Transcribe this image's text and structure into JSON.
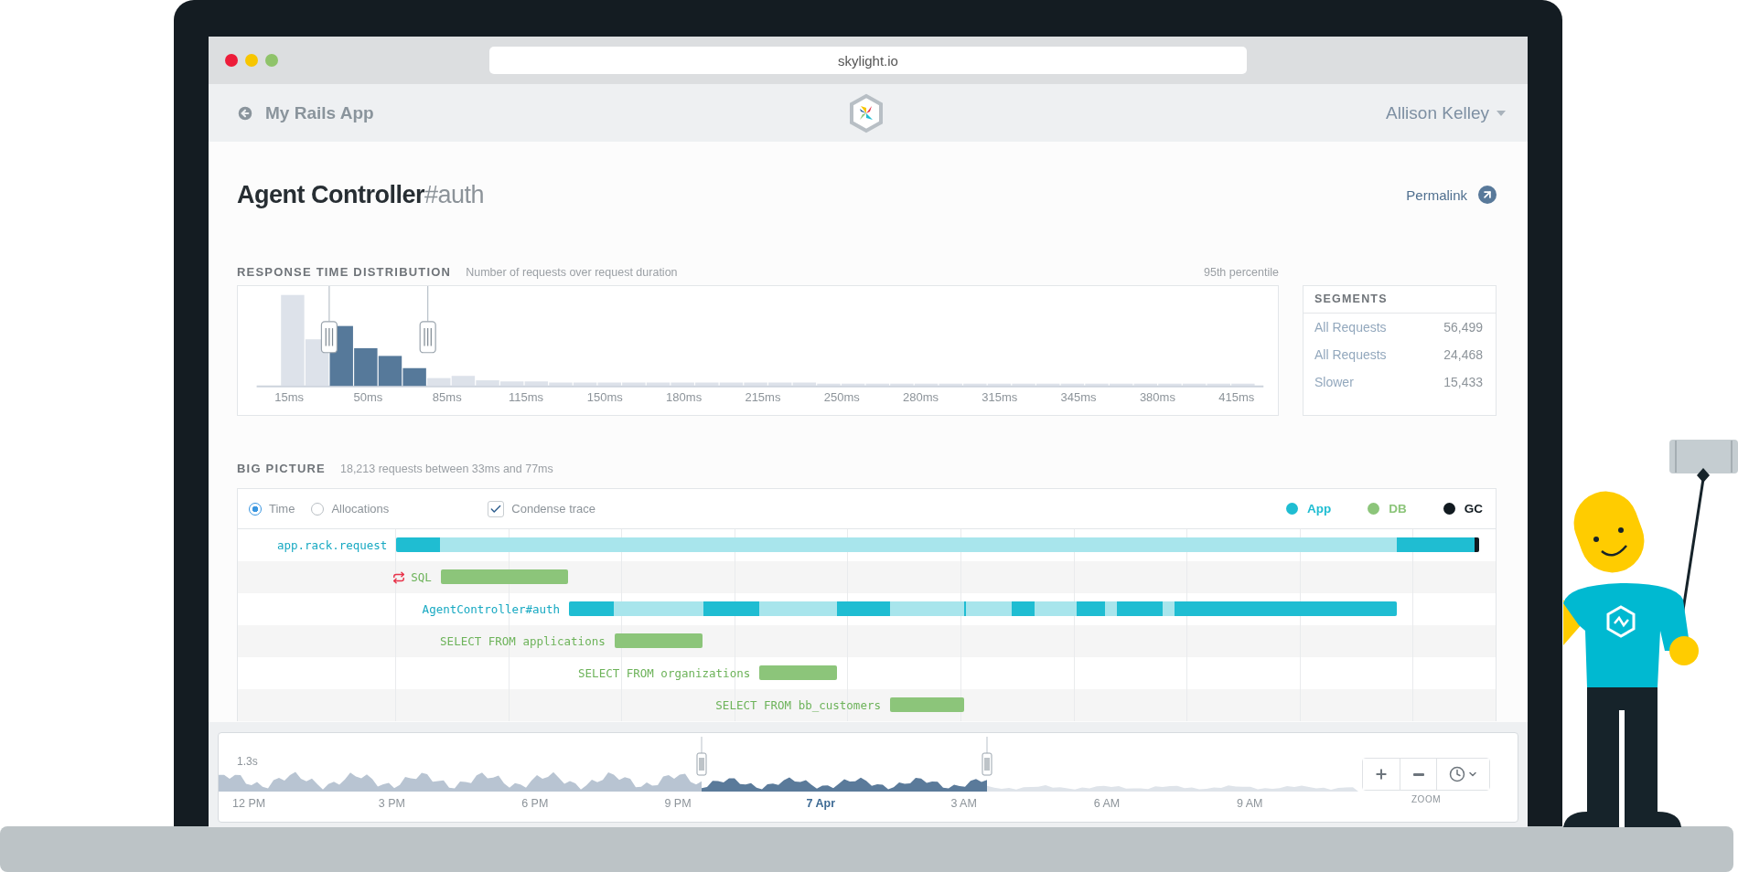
{
  "browser": {
    "url": "skylight.io"
  },
  "app_header": {
    "back_label": "My Rails App",
    "user": "Allison Kelley"
  },
  "page": {
    "title": "Agent Controller",
    "title_suffix": "#auth",
    "permalink": "Permalink"
  },
  "response_time_distribution": {
    "title": "RESPONSE TIME DISTRIBUTION",
    "subtitle": "Number of requests over request duration",
    "percentile": "95th percentile",
    "x_labels": [
      "15ms",
      "50ms",
      "85ms",
      "115ms",
      "150ms",
      "180ms",
      "215ms",
      "250ms",
      "280ms",
      "315ms",
      "345ms",
      "380ms",
      "415ms"
    ]
  },
  "segments": {
    "title": "SEGMENTS",
    "items": [
      {
        "label": "All Requests",
        "count": "56,499"
      },
      {
        "label": "All Requests",
        "count": "24,468"
      },
      {
        "label": "Slower",
        "count": "15,433"
      }
    ]
  },
  "big_picture": {
    "title": "BIG PICTURE",
    "subtitle": "18,213 requests between 33ms and 77ms",
    "modes": [
      {
        "label": "Time",
        "selected": true
      },
      {
        "label": "Allocations",
        "selected": false
      }
    ],
    "condense": {
      "label": "Condense trace",
      "checked": true
    },
    "legend": [
      {
        "label": "App",
        "color": "#1fbdd2"
      },
      {
        "label": "DB",
        "color": "#8cc57a"
      },
      {
        "label": "GC",
        "color": "#111a20"
      }
    ],
    "trace": [
      {
        "kind": "app",
        "label": "app.rack.request",
        "repeated": false,
        "children": [
          {
            "kind": "db",
            "label": "SQL",
            "repeated": true
          },
          {
            "kind": "app",
            "label": "AgentController#auth",
            "repeated": false,
            "children": [
              {
                "kind": "db",
                "label": "SELECT FROM applications",
                "repeated": false
              },
              {
                "kind": "db",
                "label": "SELECT FROM organizations",
                "repeated": false
              },
              {
                "kind": "db",
                "label": "SELECT FROM bb_customers",
                "repeated": false
              }
            ]
          }
        ]
      }
    ]
  },
  "timeline": {
    "max_label": "1.3s",
    "zoom_label": "ZOOM",
    "x_labels": [
      {
        "label": "12 PM",
        "kind": "time"
      },
      {
        "label": "3 PM",
        "kind": "time"
      },
      {
        "label": "6 PM",
        "kind": "time"
      },
      {
        "label": "9 PM",
        "kind": "time"
      },
      {
        "label": "7 Apr",
        "kind": "date"
      },
      {
        "label": "3 AM",
        "kind": "time"
      },
      {
        "label": "6 AM",
        "kind": "time"
      },
      {
        "label": "9 AM",
        "kind": "time"
      }
    ]
  }
}
